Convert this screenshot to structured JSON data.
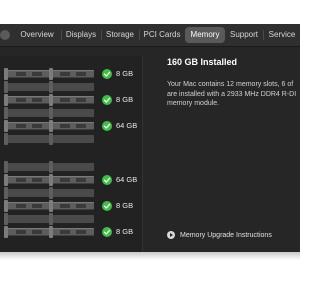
{
  "tabs": [
    {
      "label": "Overview",
      "active": false
    },
    {
      "label": "Displays",
      "active": false
    },
    {
      "label": "Storage",
      "active": false
    },
    {
      "label": "PCI Cards",
      "active": false
    },
    {
      "label": "Memory",
      "active": true
    },
    {
      "label": "Support",
      "active": false
    },
    {
      "label": "Service",
      "active": false
    }
  ],
  "slots": [
    {
      "size": "8 GB",
      "installed": true
    },
    {
      "size": "",
      "installed": false
    },
    {
      "size": "8 GB",
      "installed": true
    },
    {
      "size": "",
      "installed": false
    },
    {
      "size": "64 GB",
      "installed": true
    },
    {
      "size": "",
      "installed": false
    },
    {
      "size": "",
      "installed": false
    },
    {
      "size": "64 GB",
      "installed": true
    },
    {
      "size": "",
      "installed": false
    },
    {
      "size": "8 GB",
      "installed": true
    },
    {
      "size": "",
      "installed": false
    },
    {
      "size": "8 GB",
      "installed": true
    }
  ],
  "summary": {
    "title": "160 GB Installed",
    "line1": "Your Mac contains 12 memory slots, 6 of",
    "line2": "are installed with a 2933 MHz DDR4 R-DI",
    "line3": "memory module."
  },
  "upgrade_link": "Memory Upgrade Instructions",
  "colors": {
    "check": "#3fbf46",
    "active_tab": "#595959",
    "window_bg": "#262626"
  },
  "icons": {
    "check": "checkmark-circle-icon",
    "upgrade": "arrow-circle-icon"
  }
}
